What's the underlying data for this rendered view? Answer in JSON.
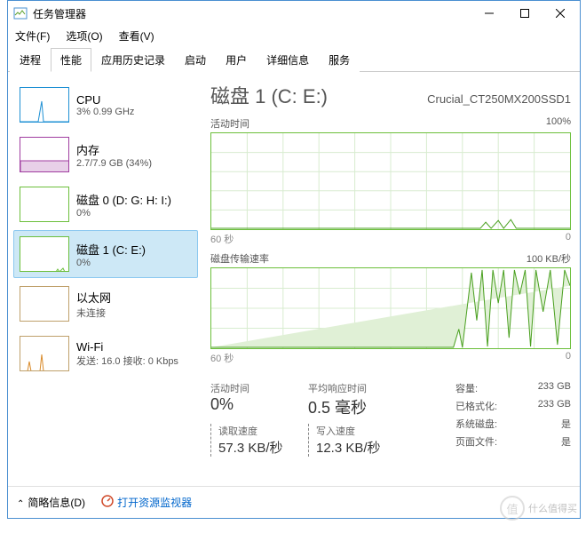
{
  "window": {
    "title": "任务管理器"
  },
  "menu": {
    "file": "文件(F)",
    "options": "选项(O)",
    "view": "查看(V)"
  },
  "tabs": {
    "processes": "进程",
    "performance": "性能",
    "app_history": "应用历史记录",
    "startup": "启动",
    "users": "用户",
    "details": "详细信息",
    "services": "服务"
  },
  "sidebar": {
    "cpu": {
      "title": "CPU",
      "sub": "3% 0.99 GHz",
      "color": "#1e90d4"
    },
    "memory": {
      "title": "内存",
      "sub": "2.7/7.9 GB (34%)",
      "color": "#a03da0"
    },
    "disk0": {
      "title": "磁盘 0 (D: G: H: I:)",
      "sub": "0%",
      "color": "#6cbf3b"
    },
    "disk1": {
      "title": "磁盘 1 (C: E:)",
      "sub": "0%",
      "color": "#6cbf3b"
    },
    "ethernet": {
      "title": "以太网",
      "sub": "未连接",
      "color": "#bfa06a"
    },
    "wifi": {
      "title": "Wi-Fi",
      "sub": "发送: 16.0 接收: 0 Kbps",
      "color": "#bfa06a"
    }
  },
  "main": {
    "title": "磁盘 1 (C: E:)",
    "model": "Crucial_CT250MX200SSD1",
    "chart1": {
      "label": "活动时间",
      "max": "100%",
      "xl": "60 秒",
      "xr": "0"
    },
    "chart2": {
      "label": "磁盘传输速率",
      "max": "100 KB/秒",
      "xl": "60 秒",
      "xr": "0"
    }
  },
  "stats": {
    "active_label": "活动时间",
    "active_value": "0%",
    "resp_label": "平均响应时间",
    "resp_value": "0.5 毫秒",
    "read_label": "读取速度",
    "read_value": "57.3 KB/秒",
    "write_label": "写入速度",
    "write_value": "12.3 KB/秒",
    "capacity_label": "容量:",
    "capacity_value": "233 GB",
    "formatted_label": "已格式化:",
    "formatted_value": "233 GB",
    "sysdisk_label": "系统磁盘:",
    "sysdisk_value": "是",
    "pagefile_label": "页面文件:",
    "pagefile_value": "是"
  },
  "bottom": {
    "fewer": "简略信息(D)",
    "resource": "打开资源监视器"
  },
  "watermark": "什么值得买",
  "chart_data": [
    {
      "type": "line",
      "title": "活动时间",
      "ylabel": "%",
      "ylim": [
        0,
        100
      ],
      "x_seconds": [
        60,
        0
      ],
      "values_pct_estimate": "near 0% mostly, small spikes to ~5-8% near right side"
    },
    {
      "type": "line",
      "title": "磁盘传输速率",
      "ylabel": "KB/秒",
      "ylim": [
        0,
        100
      ],
      "x_seconds": [
        60,
        0
      ],
      "series": [
        {
          "name": "读取",
          "note": "spikes up to ~100 KB/s in recent ~10s, mostly low before"
        },
        {
          "name": "写入",
          "note": "smaller spikes alongside read"
        }
      ]
    }
  ]
}
